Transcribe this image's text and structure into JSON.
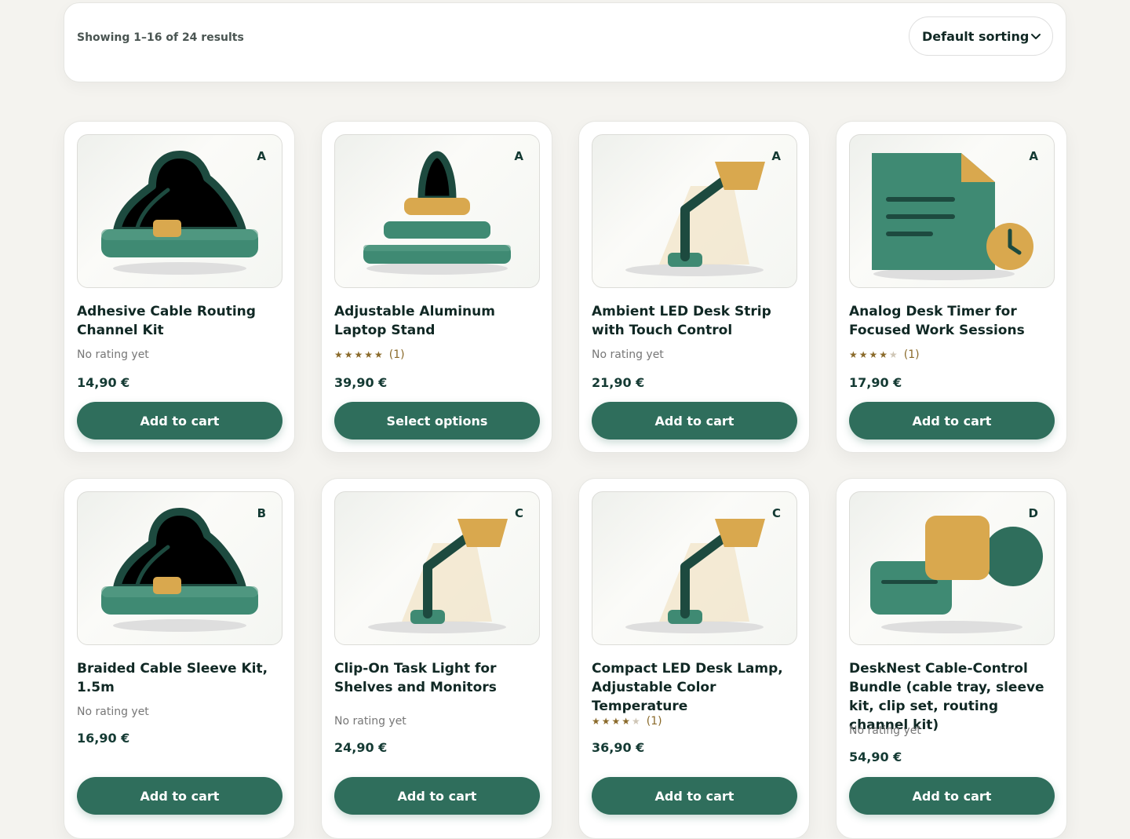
{
  "toolbar": {
    "result_count": "Showing 1–16 of 24 results",
    "sort_label": "Default sorting",
    "sort_icon": "chevron-down-icon"
  },
  "colors": {
    "accent": "#2f6e5c",
    "accent_dark": "#1d4a3f",
    "gold": "#d9a84e",
    "background": "#f4f3ef"
  },
  "products": [
    {
      "name": "Adhesive Cable Routing Channel Kit",
      "badge": "A",
      "rating_text": "No rating yet",
      "stars": null,
      "rating_count": "",
      "price": "14,90 €",
      "button": "Add to cart",
      "art": "cable-sleeve-art"
    },
    {
      "name": "Adjustable Aluminum Laptop Stand",
      "badge": "A",
      "rating_text": "",
      "stars": 5,
      "rating_count": "(1)",
      "price": "39,90 €",
      "button": "Select options",
      "art": "laptop-stand-art"
    },
    {
      "name": "Ambient LED Desk Strip with Touch Control",
      "badge": "A",
      "rating_text": "No rating yet",
      "stars": null,
      "rating_count": "",
      "price": "21,90 €",
      "button": "Add to cart",
      "art": "desk-lamp-art"
    },
    {
      "name": "Analog Desk Timer for Focused Work Sessions",
      "badge": "A",
      "rating_text": "",
      "stars": 4,
      "rating_count": "(1)",
      "price": "17,90 €",
      "button": "Add to cart",
      "art": "document-clock-art"
    },
    {
      "name": "Braided Cable Sleeve Kit, 1.5m",
      "badge": "B",
      "rating_text": "No rating yet",
      "stars": null,
      "rating_count": "",
      "price": "16,90 €",
      "button": "Add to cart",
      "art": "cable-sleeve-art"
    },
    {
      "name": "Clip-On Task Light for Shelves and Monitors",
      "badge": "C",
      "rating_text": "No rating yet",
      "stars": null,
      "rating_count": "",
      "price": "24,90 €",
      "button": "Add to cart",
      "art": "desk-lamp-art"
    },
    {
      "name": "Compact LED Desk Lamp, Adjustable Color Temperature",
      "badge": "C",
      "rating_text": "",
      "stars": 4,
      "rating_count": "(1)",
      "price": "36,90 €",
      "button": "Add to cart",
      "art": "desk-lamp-art"
    },
    {
      "name": "DeskNest Cable-Control Bundle (cable tray, sleeve kit, clip set, routing channel kit)",
      "badge": "D",
      "rating_text": "No rating yet",
      "stars": null,
      "rating_count": "",
      "price": "54,90 €",
      "button": "Add to cart",
      "art": "bundle-shapes-art"
    }
  ]
}
